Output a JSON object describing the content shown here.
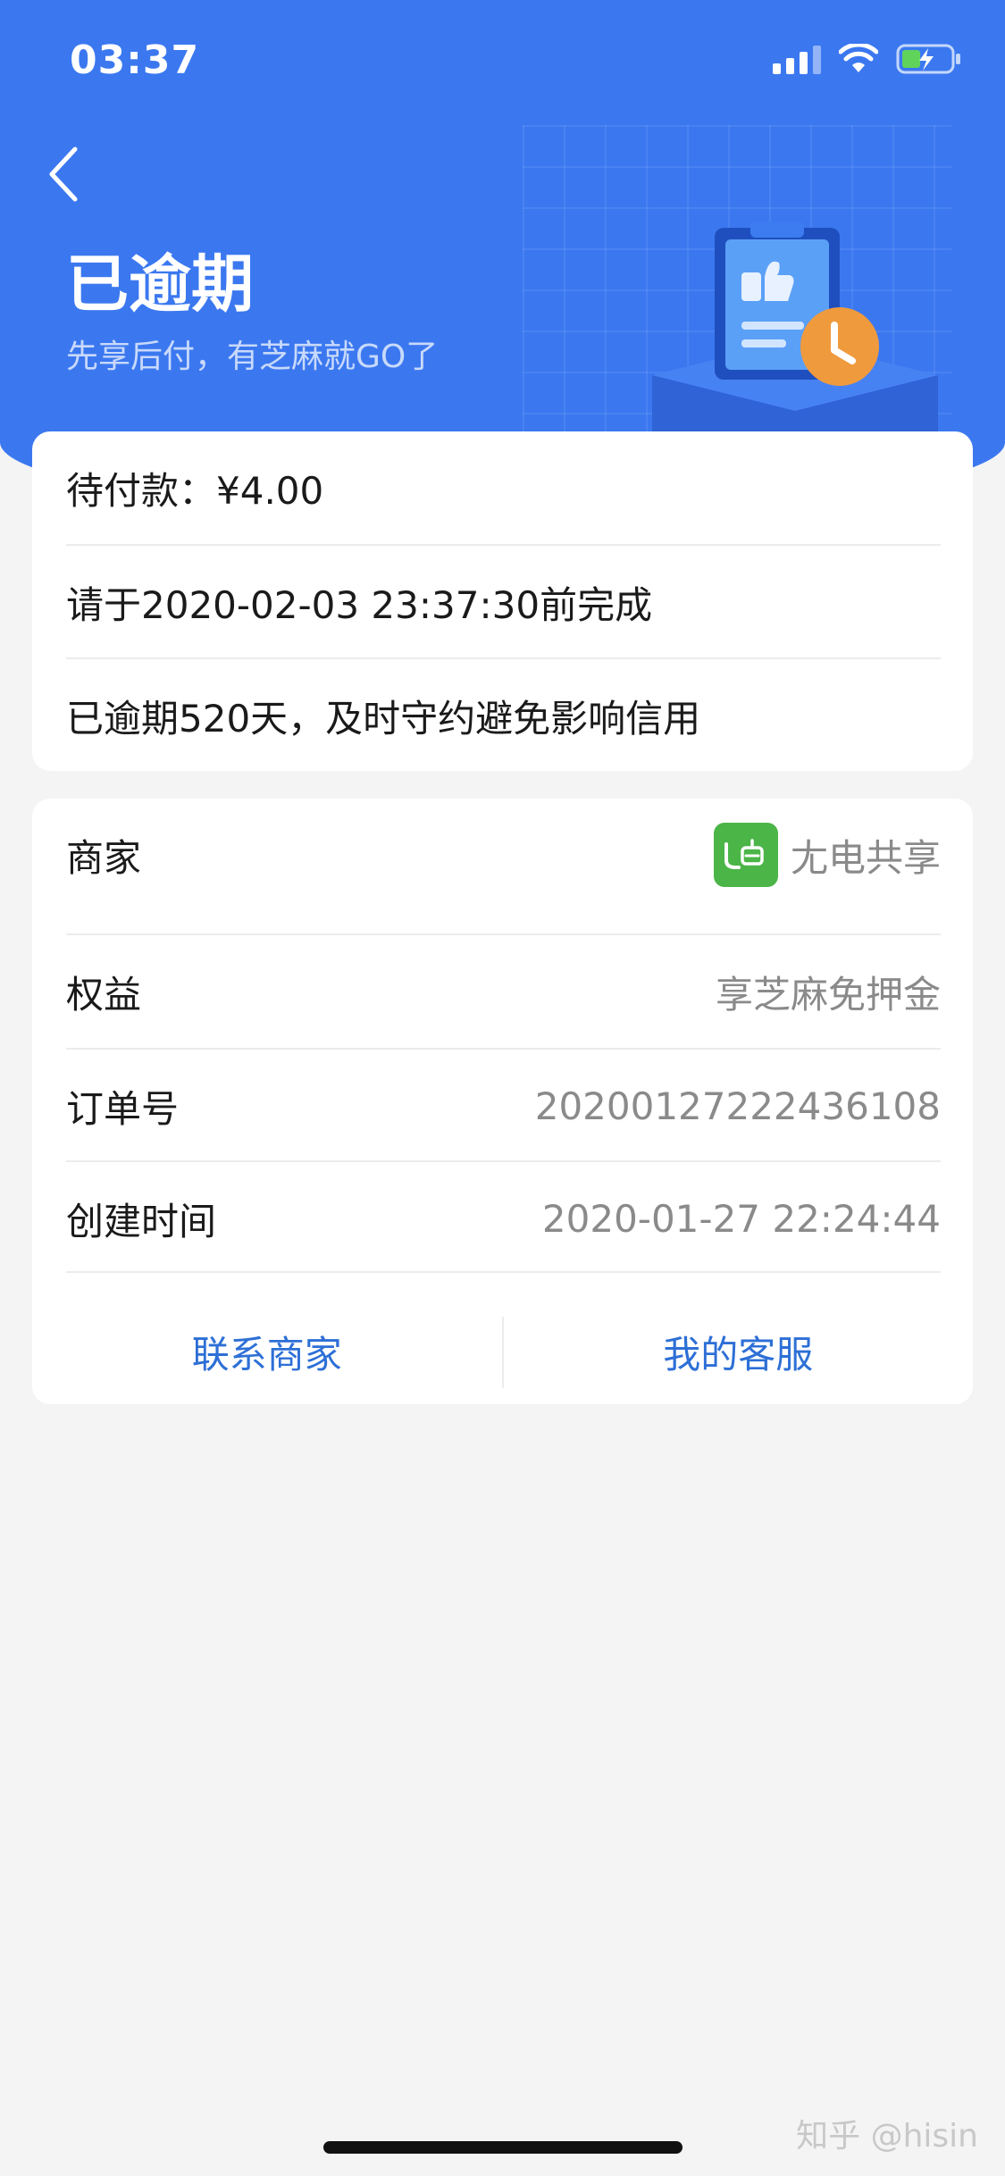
{
  "status_bar": {
    "time": "03:37"
  },
  "header": {
    "title": "已逾期",
    "subtitle": "先享后付，有芝麻就GO了"
  },
  "payment_card": {
    "amount_text": "待付款：¥4.00",
    "deadline_text": "请于2020-02-03 23:37:30前完成",
    "overdue_text": "已逾期520天，及时守约避免影响信用"
  },
  "order_card": {
    "rows": [
      {
        "label": "商家",
        "value": "尢电共享"
      },
      {
        "label": "权益",
        "value": "享芝麻免押金"
      },
      {
        "label": "订单号",
        "value": "20200127222436108"
      },
      {
        "label": "创建时间",
        "value": "2020-01-27 22:24:44"
      }
    ],
    "contact_merchant_label": "联系商家",
    "customer_service_label": "我的客服"
  },
  "watermark": "知乎 @hisin",
  "colors": {
    "header_blue": "#3b78f0",
    "link_blue": "#2d6fd6",
    "merchant_logo_green": "#4bb548",
    "clock_orange": "#f09a3e"
  }
}
